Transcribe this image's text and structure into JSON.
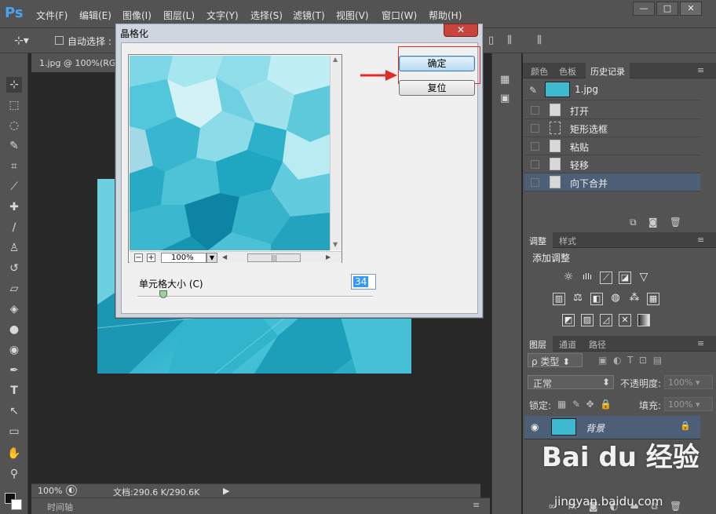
{
  "app": {
    "logo": "Ps"
  },
  "menu": [
    "文件(F)",
    "编辑(E)",
    "图像(I)",
    "图层(L)",
    "文字(Y)",
    "选择(S)",
    "滤镜(T)",
    "视图(V)",
    "窗口(W)",
    "帮助(H)"
  ],
  "window_controls": {
    "minimize": "—",
    "maximize": "□",
    "close": "✕"
  },
  "options": {
    "auto_select": "自动选择 :"
  },
  "document": {
    "tab_title": "1.jpg @ 100%(RG"
  },
  "status": {
    "zoom": "100%",
    "doc_info": "文档:290.6 K/290.6K"
  },
  "timeline": {
    "label": "时间轴"
  },
  "dialog": {
    "title": "晶格化",
    "ok_label": "确定",
    "reset_label": "复位",
    "zoom": "100%",
    "zoom_out": "−",
    "zoom_in": "+",
    "cell_size_label": "单元格大小 (C)",
    "cell_size_value": "34",
    "cell_size_level": 0.11
  },
  "panels": {
    "top_tabs": [
      "颜色",
      "色板",
      "历史记录"
    ],
    "history_snapshot": "1.jpg",
    "history": [
      "打开",
      "矩形选框",
      "粘贴",
      "轻移",
      "向下合并"
    ],
    "adjust_tabs": [
      "调整",
      "样式"
    ],
    "add_adjustment": "添加调整",
    "layer_tabs": [
      "图层",
      "通道",
      "路径"
    ],
    "filter_type": "ρ 类型",
    "blend_mode": "正常",
    "opacity_label": "不透明度:",
    "opacity_value": "100%",
    "lock_label": "锁定:",
    "fill_label": "填充:",
    "fill_value": "100%",
    "layer_name": "背景"
  },
  "watermark": {
    "brand": "Bai du 经验",
    "url": "jingyan.baidu.com"
  },
  "colors": {
    "panel": "#535353",
    "canvas": "#282828",
    "selection": "#4d5e77",
    "accent_red": "#e62a2a",
    "cyan": "#23a9c4"
  }
}
